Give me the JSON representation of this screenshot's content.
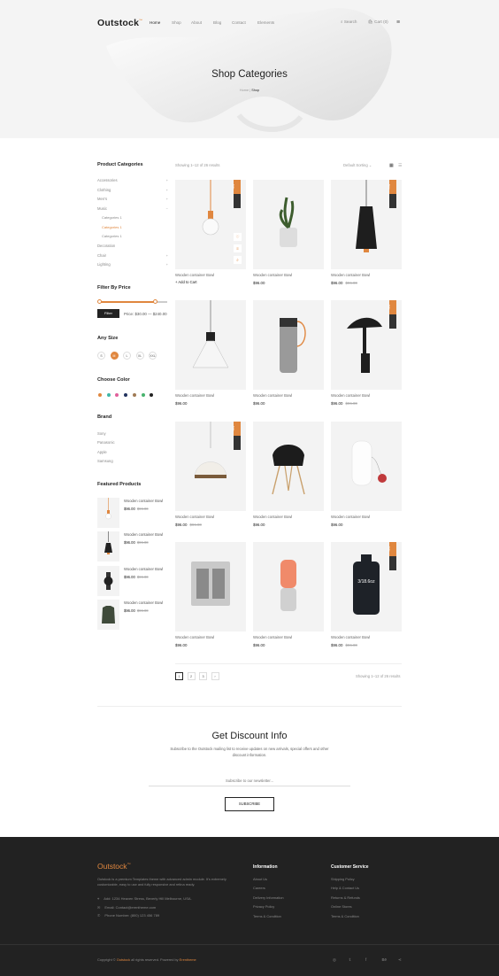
{
  "header": {
    "logo": "Outstock",
    "logo_mark": "™",
    "nav": [
      "Home",
      "Shop",
      "About",
      "Blog",
      "Contact",
      "Elements"
    ],
    "search": "Search",
    "cart": "Cart (0)"
  },
  "hero": {
    "title": "Shop Categories",
    "crumb_home": "Home",
    "crumb_sep": "|",
    "crumb_current": "Shop"
  },
  "sidebar": {
    "categories_title": "Product Categories",
    "categories": [
      {
        "label": "Accessories",
        "arrow": "+"
      },
      {
        "label": "Clothing",
        "arrow": "+"
      },
      {
        "label": "Men's",
        "arrow": "+"
      },
      {
        "label": "Music",
        "arrow": "−"
      }
    ],
    "subcategories": [
      "Categories 1",
      "Categories 1",
      "Categories 1"
    ],
    "categories2": [
      {
        "label": "Decoration",
        "arrow": ""
      },
      {
        "label": "Chair",
        "arrow": "+"
      },
      {
        "label": "Lighting",
        "arrow": "+"
      }
    ],
    "filter_title": "Filter By Price",
    "filter_button": "Filter",
    "price_range": "Price: $30.00 — $240.00",
    "price_fill_fraction": 0.82,
    "size_title": "Any Size",
    "sizes": [
      "S",
      "M",
      "L",
      "XL",
      "XXL"
    ],
    "size_selected": "M",
    "color_title": "Choose Color",
    "colors": [
      "#e0873f",
      "#3fb7a8",
      "#e0609b",
      "#22325e",
      "#a07a55",
      "#47b36e",
      "#222222"
    ],
    "brand_title": "Brand",
    "brands": [
      "Sony",
      "Panasonic",
      "Apple",
      "Samsung"
    ],
    "featured_title": "Featured Products",
    "featured": [
      {
        "name": "Wooden container Bowl",
        "price": "$96.00",
        "old": "$96.00"
      },
      {
        "name": "Wooden container Bowl",
        "price": "$96.00",
        "old": "$96.00"
      },
      {
        "name": "Wooden container Bowl",
        "price": "$96.00",
        "old": "$96.00"
      },
      {
        "name": "Wooden container Bowl",
        "price": "$96.00",
        "old": "$96.00"
      }
    ]
  },
  "toolbar": {
    "showing": "Showing 1–12 of 26 results",
    "sort": "Default Sorting"
  },
  "products": [
    {
      "name": "Wooden container Bowl",
      "price": "",
      "old": "",
      "badge": "Sale",
      "img": "pendant-bulb"
    },
    {
      "name": "Wooden container Bowl",
      "price": "$96.00",
      "old": "",
      "badge": "",
      "img": "plant"
    },
    {
      "name": "Wooden container Bowl",
      "price": "$96.00",
      "old": "$96.00",
      "badge": "New",
      "img": "black-lamp"
    },
    {
      "name": "Wooden container Bowl",
      "price": "$96.00",
      "old": "",
      "badge": "",
      "img": "glass-pendant"
    },
    {
      "name": "Wooden container Bowl",
      "price": "$96.00",
      "old": "",
      "badge": "",
      "img": "bottle"
    },
    {
      "name": "Wooden container Bowl",
      "price": "$96.00",
      "old": "$96.00",
      "badge": "Sale",
      "img": "desk-lamp"
    },
    {
      "name": "Wooden container Bowl",
      "price": "$96.00",
      "old": "$96.00",
      "badge": "Sale",
      "img": "wood-pendant"
    },
    {
      "name": "Wooden container Bowl",
      "price": "$96.00",
      "old": "",
      "badge": "",
      "img": "chair"
    },
    {
      "name": "Wooden container Bowl",
      "price": "$96.00",
      "old": "",
      "badge": "",
      "img": "white-lamp"
    },
    {
      "name": "Wooden container Bowl",
      "price": "$96.00",
      "old": "",
      "badge": "",
      "img": "speaker"
    },
    {
      "name": "Wooden container Bowl",
      "price": "$96.00",
      "old": "",
      "badge": "",
      "img": "orange-bottle"
    },
    {
      "name": "Wooden container Bowl",
      "price": "$96.00",
      "old": "$96.00",
      "badge": "Sale",
      "img": "black-bottle"
    }
  ],
  "product_hover": {
    "add_to_cart": "+ Add to Cart"
  },
  "bottle_label": "3/18.6oz",
  "pagination": {
    "pages": [
      "1",
      "2",
      "3",
      "›"
    ],
    "showing": "Showing 1–12 of 26 results"
  },
  "newsletter": {
    "title": "Get Discount Info",
    "text": "Subscribe to the Outstock mailing list to receive updates on new arrivals, special offers and other discount information.",
    "placeholder": "Subscribe to our newsletter...",
    "button": "SUBSCRIBE"
  },
  "footer": {
    "logo": "Outstock",
    "about": "Outstock is a premium Templates theme with advanced admin module. It's extremely customizable, easy to use and fully responsive and retina ready.",
    "address": "Add: 1234 Heaven Stress, Beverly Hill Melbourne, USA.",
    "email": "Email: Contact@erentheme.com",
    "phone": "Phone Number: (800) 123 456 789",
    "info_title": "Information",
    "info_links": [
      "About Us",
      "Careers",
      "Delivery Information",
      "Privacy Policy",
      "Terms & Condition"
    ],
    "service_title": "Customer Service",
    "service_links": [
      "Shipping Policy",
      "Help & Contact Us",
      "Returns & Refunds",
      "Online Stores",
      "Terms & Condition"
    ],
    "copy_pre": "Copyright ©",
    "copy_brand": "Outstock",
    "copy_mid": "all rights reserved. Powered by",
    "copy_power": "Erentheme",
    "social": [
      "instagram-icon",
      "twitter-icon",
      "facebook-icon",
      "behance-icon",
      "share-icon"
    ]
  }
}
